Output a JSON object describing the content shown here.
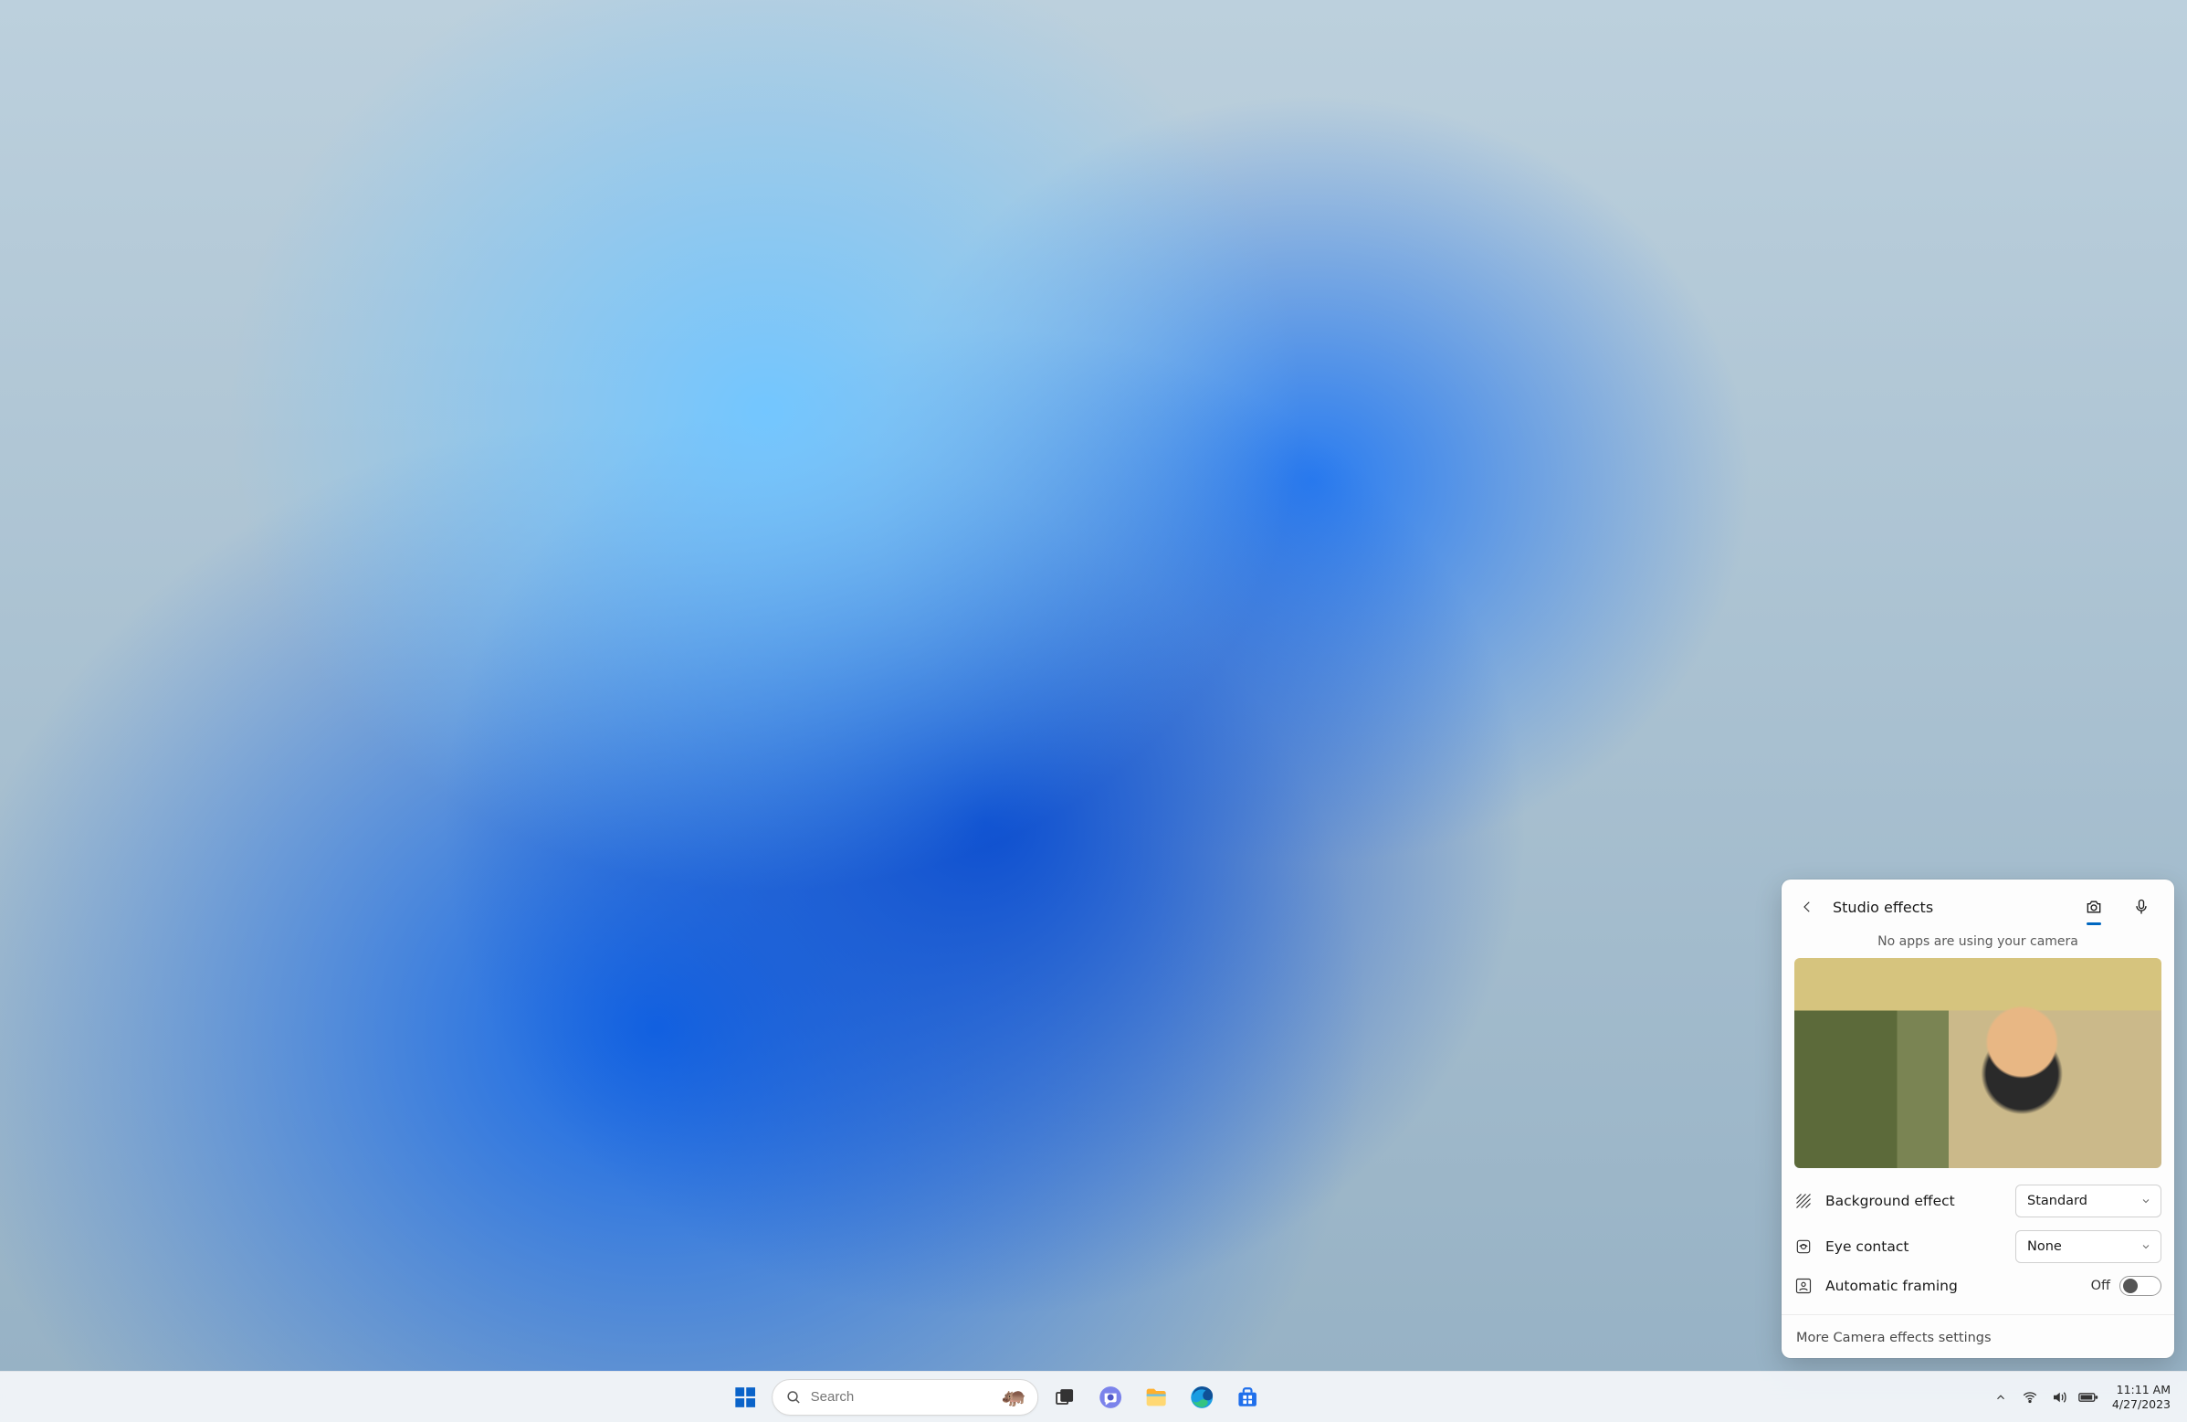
{
  "flyout": {
    "title": "Studio effects",
    "tabs": {
      "active": "camera"
    },
    "status_line": "No apps are using your camera",
    "settings": {
      "background_effect": {
        "label": "Background effect",
        "value": "Standard"
      },
      "eye_contact": {
        "label": "Eye contact",
        "value": "None"
      },
      "automatic_framing": {
        "label": "Automatic framing",
        "state_label": "Off",
        "enabled": false
      }
    },
    "more_link": "More Camera effects settings"
  },
  "taskbar": {
    "search_placeholder": "Search",
    "search_emoji": "🦛",
    "clock_time": "11:11 AM",
    "clock_date": "4/27/2023"
  }
}
